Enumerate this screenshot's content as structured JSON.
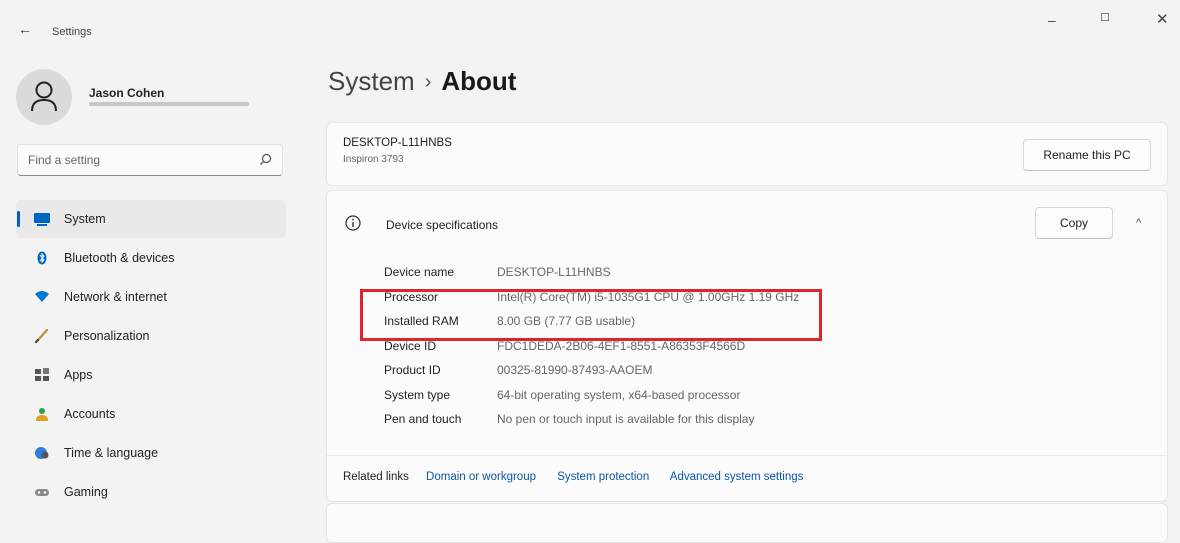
{
  "window": {
    "title": "Settings",
    "back_icon": "arrow-left-icon",
    "minimize": "–",
    "maximize": "☐",
    "close": "✕"
  },
  "profile": {
    "name": "Jason Cohen"
  },
  "search": {
    "placeholder": "Find a setting"
  },
  "nav": {
    "items": [
      {
        "label": "System",
        "icon": "system-icon",
        "color": "#0067c0",
        "active": true
      },
      {
        "label": "Bluetooth & devices",
        "icon": "bluetooth-icon",
        "color": "#0067c0"
      },
      {
        "label": "Network & internet",
        "icon": "wifi-icon",
        "color": "#0078d4"
      },
      {
        "label": "Personalization",
        "icon": "brush-icon",
        "color": "#d48a1a"
      },
      {
        "label": "Apps",
        "icon": "apps-icon",
        "color": "#555555"
      },
      {
        "label": "Accounts",
        "icon": "accounts-icon",
        "color": "#2e9e4f"
      },
      {
        "label": "Time & language",
        "icon": "globe-clock-icon",
        "color": "#2b7fd6"
      },
      {
        "label": "Gaming",
        "icon": "gamepad-icon",
        "color": "#888888"
      }
    ]
  },
  "page": {
    "crumb": "System",
    "separator": "›",
    "current": "About"
  },
  "pc": {
    "name": "DESKTOP-L11HNBS",
    "model": "Inspiron 3793",
    "rename_label": "Rename this PC"
  },
  "specs": {
    "title": "Device specifications",
    "copy_label": "Copy",
    "rows": [
      {
        "key": "Device name",
        "value": "DESKTOP-L11HNBS"
      },
      {
        "key": "Processor",
        "value": "Intel(R) Core(TM) i5-1035G1 CPU @ 1.00GHz   1.19 GHz"
      },
      {
        "key": "Installed RAM",
        "value": "8.00 GB (7.77 GB usable)"
      },
      {
        "key": "Device ID",
        "value": "FDC1DEDA-2B06-4EF1-8551-A86353F4566D"
      },
      {
        "key": "Product ID",
        "value": "00325-81990-87493-AAOEM"
      },
      {
        "key": "System type",
        "value": "64-bit operating system, x64-based processor"
      },
      {
        "key": "Pen and touch",
        "value": "No pen or touch input is available for this display"
      }
    ],
    "related_label": "Related links",
    "links": [
      "Domain or workgroup",
      "System protection",
      "Advanced system settings"
    ]
  },
  "annotation": {
    "color": "#e0242c"
  }
}
